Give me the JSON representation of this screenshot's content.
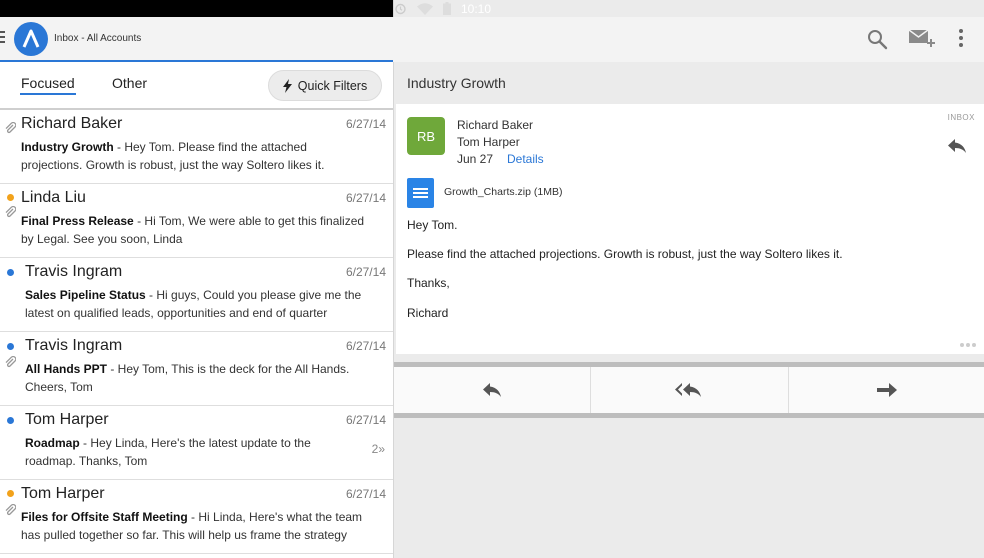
{
  "status_bar": {
    "time": "10:10"
  },
  "app_bar": {
    "title": "Inbox - All Accounts"
  },
  "tabs": {
    "focused": "Focused",
    "other": "Other",
    "quick_filters": "Quick Filters"
  },
  "messages": [
    {
      "sender": "Richard Baker",
      "date": "6/27/14",
      "subject": "Industry Growth",
      "snippet_1": " - Hey Tom. Please find the attached",
      "snippet_2": "projections. Growth is robust, just the way Soltero likes it.",
      "flag": "none",
      "attachment": true,
      "count": ""
    },
    {
      "sender": "Linda Liu",
      "date": "6/27/14",
      "subject": "Final Press Release",
      "snippet_1": " - Hi Tom, We were able to get this finalized",
      "snippet_2": "by Legal. See you soon, Linda",
      "flag": "orange",
      "attachment": true,
      "count": ""
    },
    {
      "sender": "Travis Ingram",
      "date": "6/27/14",
      "subject": "Sales Pipeline Status",
      "snippet_1": " - Hi guys, Could you please give me the",
      "snippet_2": "latest on qualified leads, opportunities and end of quarter",
      "flag": "blue",
      "attachment": false,
      "count": ""
    },
    {
      "sender": "Travis Ingram",
      "date": "6/27/14",
      "subject": "All Hands PPT",
      "snippet_1": " - Hey Tom, This is the deck for the All Hands.",
      "snippet_2": "Cheers, Tom",
      "flag": "blue",
      "attachment": true,
      "count": ""
    },
    {
      "sender": "Tom Harper",
      "date": "6/27/14",
      "subject": "Roadmap",
      "snippet_1": " - Hey Linda, Here's the latest update to the",
      "snippet_2": "roadmap. Thanks, Tom",
      "flag": "blue",
      "attachment": false,
      "count": "2"
    },
    {
      "sender": "Tom Harper",
      "date": "6/27/14",
      "subject": "Files for Offsite Staff Meeting",
      "snippet_1": " - Hi Linda, Here's what the team",
      "snippet_2": "has pulled together so far. This will help us frame the strategy",
      "flag": "orange",
      "attachment": true,
      "count": ""
    }
  ],
  "reading_pane": {
    "subject": "Industry Growth",
    "folder_tag": "INBOX",
    "avatar_initials": "RB",
    "from": "Richard Baker",
    "to": "Tom Harper",
    "date": "Jun 27",
    "details_link": "Details",
    "attachment": "Growth_Charts.zip (1MB)",
    "body": [
      "Hey Tom.",
      "Please find the attached projections. Growth is robust, just the way Soltero likes it.",
      "Thanks,",
      "Richard"
    ]
  },
  "colors": {
    "accent": "#2a77d6",
    "avatar": "#6fa83a",
    "flag_orange": "#f2a21b"
  },
  "icons": [
    "menu-icon",
    "app-logo-icon",
    "search-icon",
    "compose-icon",
    "overflow-icon",
    "lightning-icon",
    "paperclip-icon",
    "reply-icon",
    "reply-all-icon",
    "forward-icon",
    "file-icon",
    "alarm-icon",
    "wifi-icon",
    "battery-icon"
  ]
}
